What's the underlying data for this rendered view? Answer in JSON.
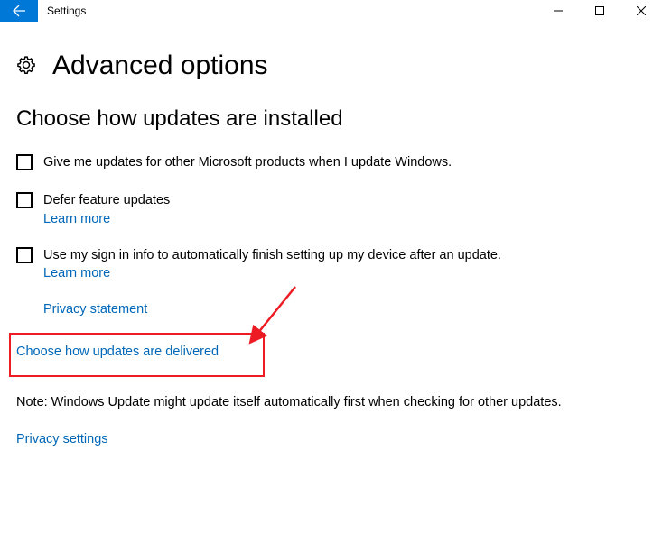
{
  "window": {
    "title": "Settings"
  },
  "page": {
    "title": "Advanced options",
    "section_title": "Choose how updates are installed"
  },
  "options": {
    "otherProducts": {
      "label": "Give me updates for other Microsoft products when I update Windows."
    },
    "defer": {
      "label": "Defer feature updates",
      "learn_more": "Learn more"
    },
    "signin": {
      "label": "Use my sign in info to automatically finish setting up my device after an update.",
      "learn_more": "Learn more"
    }
  },
  "links": {
    "privacy_statement": "Privacy statement",
    "delivery": "Choose how updates are delivered",
    "privacy_settings": "Privacy settings"
  },
  "note": "Note: Windows Update might update itself automatically first when checking for other updates."
}
